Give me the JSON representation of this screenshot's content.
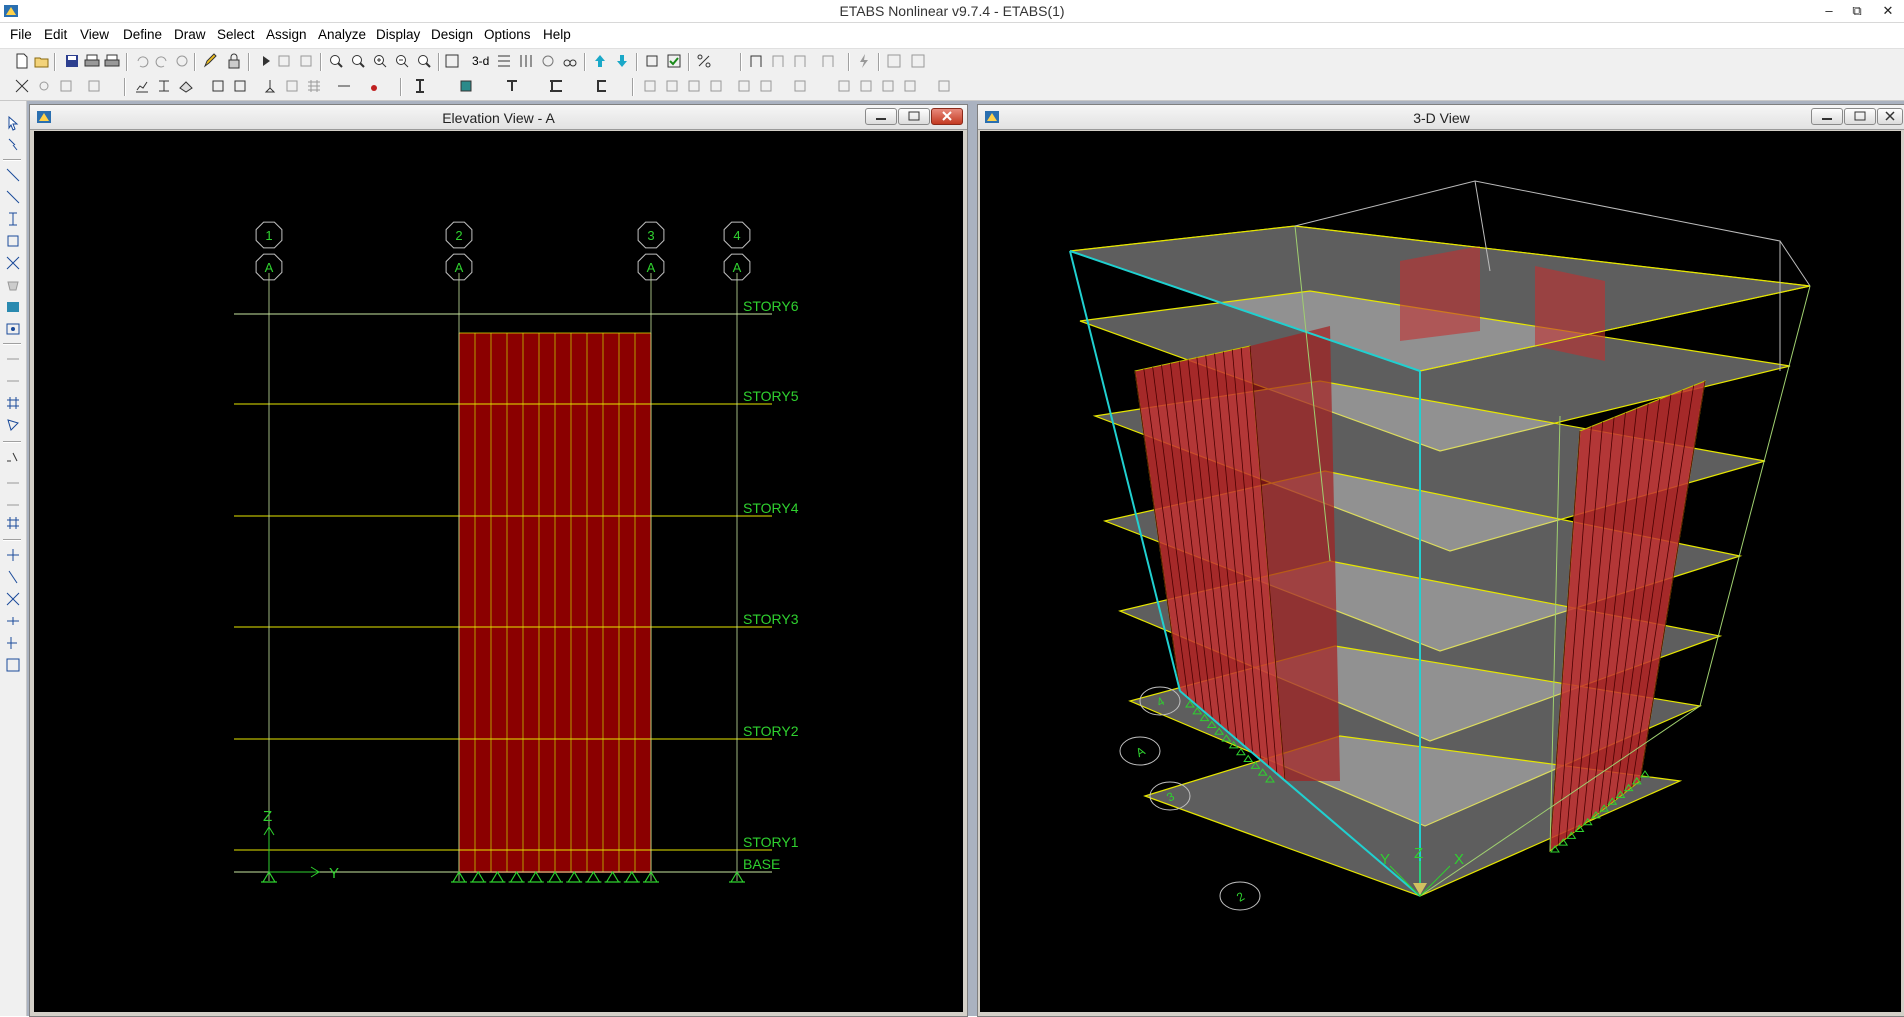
{
  "app": {
    "title": "ETABS Nonlinear v9.7.4 - ETABS(1)"
  },
  "menu": [
    "File",
    "Edit",
    "View",
    "Define",
    "Draw",
    "Select",
    "Assign",
    "Analyze",
    "Display",
    "Design",
    "Options",
    "Help"
  ],
  "toolbar": {
    "view_3d_label": "3-d"
  },
  "elevation": {
    "title": "Elevation View - A",
    "grid_numbers": [
      "1",
      "2",
      "3",
      "4"
    ],
    "grid_letter": "A",
    "stories": [
      "STORY6",
      "STORY5",
      "STORY4",
      "STORY3",
      "STORY2",
      "STORY1",
      "BASE"
    ],
    "axis_z": "Z",
    "axis_y": "Y"
  },
  "view3d": {
    "title": "3-D View",
    "bubbles": [
      "4",
      "A",
      "3",
      "2"
    ],
    "axis_x": "X",
    "axis_y": "Y",
    "axis_z": "Z"
  },
  "colors": {
    "grid_line": "#c8e6a0",
    "story_line": "#e6e600",
    "wall_fill": "#8b0000",
    "wall_stroke": "#c2c200",
    "support": "#2fd12f",
    "label_green": "#2fd12f",
    "cyan_line": "#20d0d0"
  }
}
